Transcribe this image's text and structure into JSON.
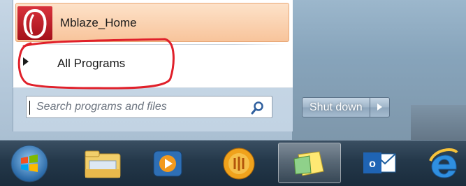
{
  "start_menu": {
    "pinned_program": {
      "label": "Mblaze_Home",
      "icon": "mblaze-icon"
    },
    "all_programs": {
      "label": "All Programs",
      "icon": "arrow-right-icon"
    },
    "search": {
      "placeholder": "Search programs and files",
      "icon": "search-icon"
    },
    "shutdown": {
      "label": "Shut down",
      "arrow_icon": "arrow-right-icon"
    }
  },
  "taskbar": {
    "items": [
      {
        "name": "start-orb",
        "icon": "windows-start-orb-icon"
      },
      {
        "name": "windows-explorer",
        "icon": "folder-icon"
      },
      {
        "name": "media-player",
        "icon": "media-player-icon"
      },
      {
        "name": "mblaze",
        "icon": "mblaze-taskbar-icon"
      },
      {
        "name": "sticky-notes",
        "icon": "sticky-notes-icon",
        "active": true
      },
      {
        "name": "outlook",
        "icon": "outlook-icon"
      },
      {
        "name": "internet-explorer",
        "icon": "internet-explorer-icon"
      }
    ]
  },
  "colors": {
    "highlight": "#f8c49b",
    "annotation": "#e0202a",
    "taskbar": "#24384a"
  }
}
